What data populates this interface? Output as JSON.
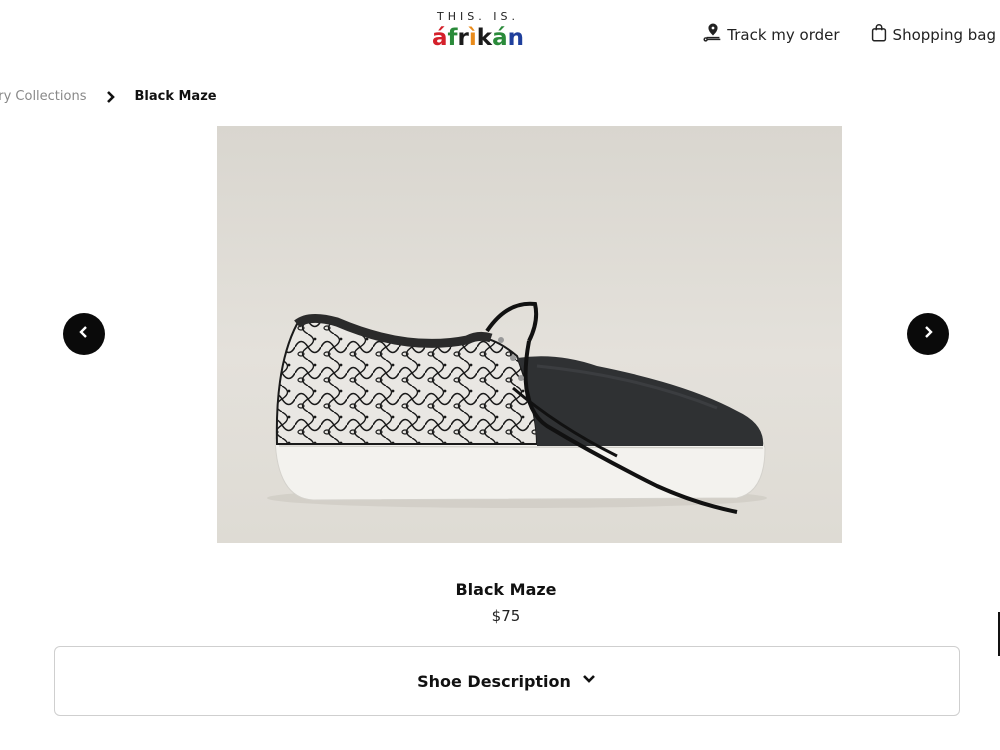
{
  "header": {
    "logo_top": "THIS. IS.",
    "logo_letters": [
      "á",
      "f",
      "r",
      "ì",
      "k",
      "á",
      "n"
    ],
    "logo_colors": [
      "#d4202a",
      "#2a8a3a",
      "#1b1b1b",
      "#e88a1a",
      "#1b1b1b",
      "#2a8a3a",
      "#1f3f9c"
    ],
    "track_order_label": "Track my order",
    "track_icon": "location-pin-icon",
    "shopping_bag_label": "Shopping bag",
    "bag_icon": "shopping-bag-icon"
  },
  "breadcrumb": {
    "previous": "ury Collections",
    "separator_icon": "chevron-right-icon",
    "current": "Black Maze"
  },
  "carousel": {
    "prev_icon": "chevron-left-icon",
    "next_icon": "chevron-right-icon"
  },
  "product": {
    "name": "Black Maze",
    "price": "$75"
  },
  "description": {
    "label": "Shoe Description",
    "icon": "chevron-down-icon"
  }
}
